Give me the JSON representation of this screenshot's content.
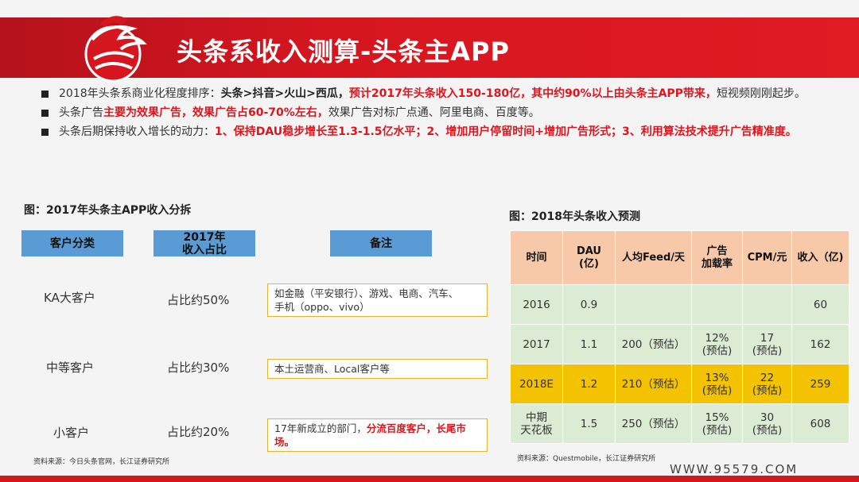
{
  "header": {
    "title": "头条系收入测算-头条主APP"
  },
  "bullets": {
    "b1": {
      "p1": "2018年头条系商业化程度排序：",
      "p2": "头条>抖音>火山>西瓜，",
      "p3": "预计2017年头条收入150-180亿，其中约90%以上由头条主APP带来，",
      "p4": "短视频刚刚起步。"
    },
    "b2": {
      "p1": "头条广告",
      "p2": "主要为效果广告，效果广告占60-70%左右，",
      "p3": "效果广告对标广点通、阿里电商、百度等。"
    },
    "b3": {
      "p1": "头条后期保持收入增长的动力：",
      "p2": "1、保持DAU稳步增长至1.3-1.5亿水平；2、增加用户停留时间+增加广告形式；3、利用算法技术提升广告精准度。"
    }
  },
  "left_figure": {
    "title": "图：2017年头条主APP收入分拆",
    "headers": {
      "category": "客户分类",
      "share_l1": "2017年",
      "share_l2": "收入占比",
      "remark": "备注"
    },
    "rows": [
      {
        "category": "KA大客户",
        "share": "占比约50%",
        "remark_l1": "如金融（平安银行）、游戏、电商、汽车、",
        "remark_l2": "手机（oppo、vivo）"
      },
      {
        "category": "中等客户",
        "share": "占比约30%",
        "remark_l1": "本土运营商、Local客户等"
      },
      {
        "category": "小客户",
        "share": "占比约20%",
        "remark_a": "17年新成立的部门，",
        "remark_b": "分流百度客户，长尾市场。"
      }
    ],
    "source": "资料来源：今日头条官网，长江证券研究所"
  },
  "right_figure": {
    "title": "图：2018年头条收入预测",
    "headers": {
      "time": "时间",
      "dau_l1": "DAU",
      "dau_l2": "(亿)",
      "feed": "人均Feed/天",
      "ad_l1": "广告",
      "ad_l2": "加载率",
      "cpm": "CPM/元",
      "rev": "收入（亿)"
    },
    "rows": [
      {
        "time": "2016",
        "dau": "0.9",
        "feed": "",
        "ad_l1": "",
        "ad_l2": "",
        "cpm_l1": "",
        "cpm_l2": "",
        "rev": "60"
      },
      {
        "time": "2017",
        "dau": "1.1",
        "feed": "200（预估）",
        "ad_l1": "12%",
        "ad_l2": "(预估)",
        "cpm_l1": "17",
        "cpm_l2": "(预估)",
        "rev": "162"
      },
      {
        "time": "2018E",
        "dau": "1.2",
        "feed": "210（预估）",
        "ad_l1": "13%",
        "ad_l2": "(预估)",
        "cpm_l1": "22",
        "cpm_l2": "(预估)",
        "rev": "259"
      },
      {
        "time_l1": "中期",
        "time_l2": "天花板",
        "dau": "1.5",
        "feed": "250（预估）",
        "ad_l1": "15%",
        "ad_l2": "(预估)",
        "cpm_l1": "30",
        "cpm_l2": "(预估)",
        "rev": "608"
      }
    ],
    "source": "资料来源：Questmobile，长江证券研究所"
  },
  "footer": {
    "website": "WWW.95579.COM"
  },
  "colors": {
    "brand_red": "#d6161f",
    "header_blue": "#5b9bd5",
    "table_head": "#f8c9a8",
    "table_green": "#dcebd3",
    "highlight": "#f3c200"
  }
}
